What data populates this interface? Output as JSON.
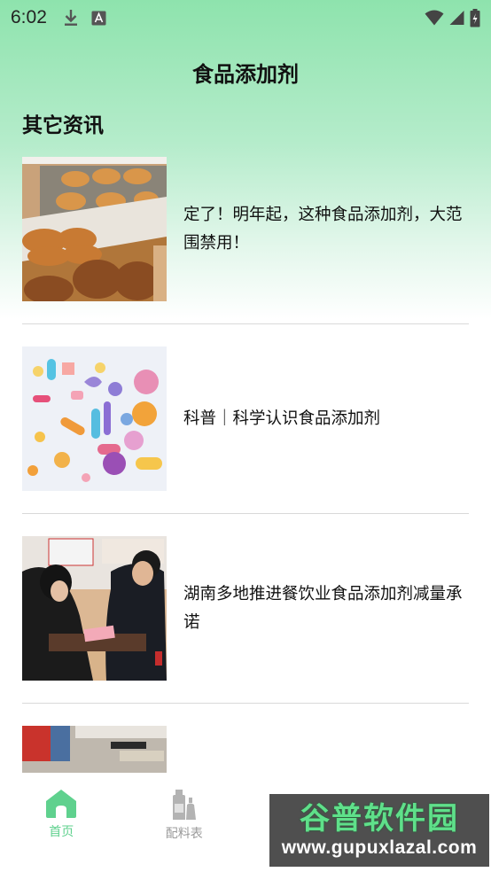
{
  "status_bar": {
    "time": "6:02"
  },
  "header": {
    "title": "食品添加剂"
  },
  "section": {
    "title": "其它资讯"
  },
  "news": [
    {
      "title": "定了！明年起，这种食品添加剂，大范围禁用！",
      "thumb_icon": "bread-pastry-image"
    },
    {
      "title": "科普｜科学认识食品添加剂",
      "thumb_icon": "candy-illustration-image"
    },
    {
      "title": "湖南多地推进餐饮业食品添加剂减量承诺",
      "thumb_icon": "inspection-photo-image"
    },
    {
      "title": "",
      "thumb_icon": "banner-photo-image"
    }
  ],
  "bottom_nav": {
    "tabs": [
      {
        "label": "首页",
        "icon": "home-icon",
        "active": true
      },
      {
        "label": "配料表",
        "icon": "bottles-icon",
        "active": false
      },
      {
        "label": "",
        "icon": "tab-icon-3",
        "active": false
      },
      {
        "label": "",
        "icon": "tab-icon-4",
        "active": false
      }
    ]
  },
  "watermark": {
    "text": "谷普软件园",
    "url": "www.gupuxlazal.com"
  },
  "colors": {
    "accent": "#5fd18e",
    "gradient_top": "#8ee3ad",
    "inactive": "#9a9a9a"
  }
}
